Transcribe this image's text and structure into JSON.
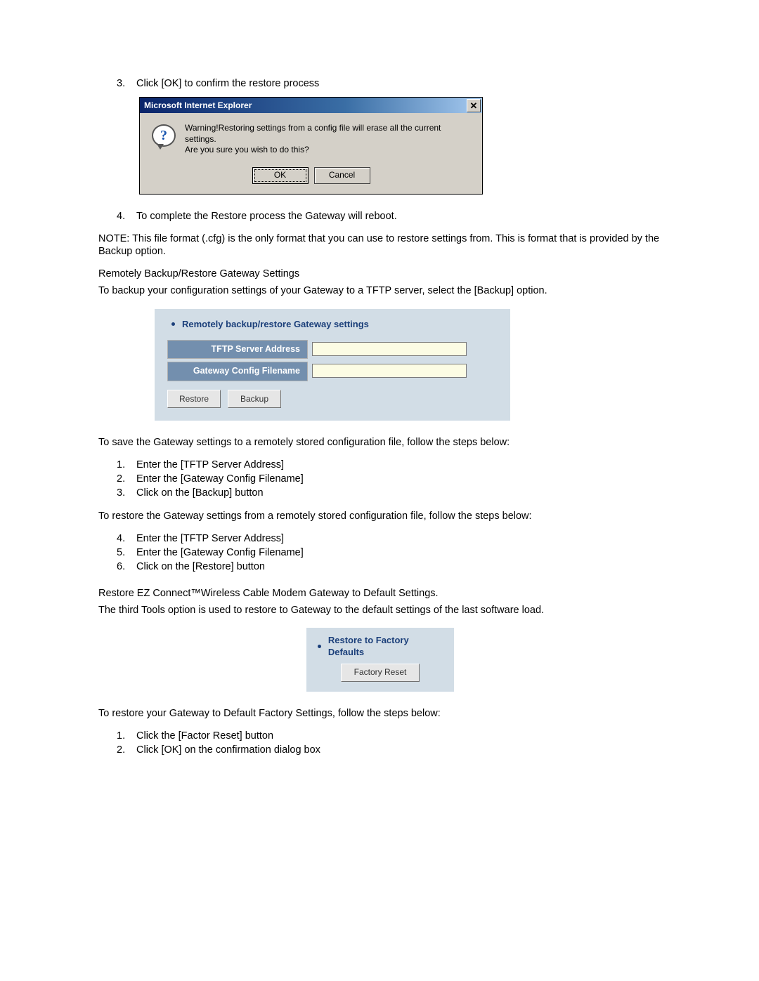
{
  "step3": {
    "num": "3.",
    "text": "Click [OK] to confirm the restore process"
  },
  "dialog": {
    "title": "Microsoft Internet Explorer",
    "message_line1": "Warning!Restoring settings from a config file will erase all the current settings.",
    "message_line2": "Are you sure you wish to do this?",
    "ok_label": "OK",
    "cancel_label": "Cancel",
    "icon_glyph": "?"
  },
  "step4": {
    "num": "4.",
    "text": "To complete the Restore process the Gateway will reboot."
  },
  "note": "NOTE: This file format (.cfg) is the only format that you can use to restore settings from. This is format that is provided by the Backup option.",
  "remote_heading": "Remotely Backup/Restore Gateway Settings",
  "remote_intro": "To backup your configuration settings of your Gateway to a TFTP server, select the [Backup] option.",
  "remote_panel": {
    "title": "Remotely backup/restore Gateway settings",
    "row1_label": "TFTP Server Address",
    "row2_label": "Gateway Config Filename",
    "restore_label": "Restore",
    "backup_label": "Backup"
  },
  "save_intro": "To save the Gateway settings to a remotely stored configuration file, follow the steps below:",
  "save_steps": {
    "s1n": "1.",
    "s1": "Enter the [TFTP Server Address]",
    "s2n": "2.",
    "s2": "Enter the [Gateway Config Filename]",
    "s3n": "3.",
    "s3": "Click on the [Backup] button"
  },
  "restore_intro": "To restore the Gateway settings from a remotely stored configuration file, follow the steps below:",
  "restore_steps": {
    "s4n": "4.",
    "s4": "Enter the [TFTP Server Address]",
    "s5n": "5.",
    "s5": "Enter the [Gateway Config Filename]",
    "s6n": "6.",
    "s6": "Click on the [Restore] button"
  },
  "defaults_heading": "Restore EZ Connect™Wireless Cable Modem Gateway to Default Settings.",
  "defaults_intro": "The third Tools option is used to restore to Gateway to the default settings of the last software load.",
  "factory_panel": {
    "title": "Restore to Factory Defaults",
    "button_label": "Factory Reset"
  },
  "defaults_followup": "To restore your Gateway to Default Factory Settings, follow the steps below:",
  "defaults_steps": {
    "d1n": "1.",
    "d1": "Click the [Factor Reset] button",
    "d2n": "2.",
    "d2": "Click [OK] on the confirmation dialog box"
  }
}
